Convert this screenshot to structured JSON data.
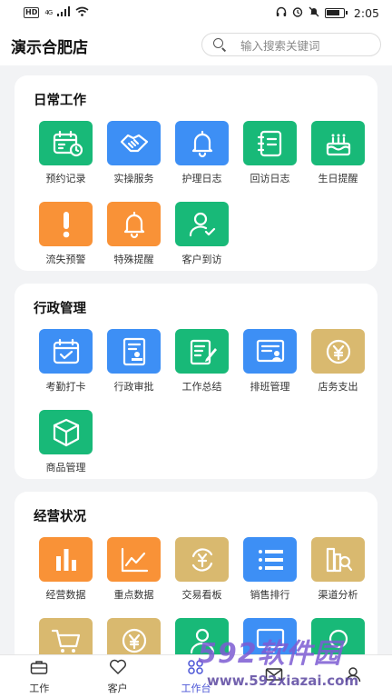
{
  "status_bar": {
    "hd": "HD",
    "network": "4G",
    "time": "2:05"
  },
  "header": {
    "store_name": "演示合肥店",
    "search_placeholder": "输入搜索关键词"
  },
  "sections": [
    {
      "title": "日常工作",
      "items": [
        {
          "label": "预约记录",
          "icon": "calendar-clock-icon",
          "color": "#18b978"
        },
        {
          "label": "实操服务",
          "icon": "handshake-icon",
          "color": "#3d8ff5"
        },
        {
          "label": "护理日志",
          "icon": "bell-icon",
          "color": "#3d8ff5"
        },
        {
          "label": "回访日志",
          "icon": "notebook-icon",
          "color": "#18b978"
        },
        {
          "label": "生日提醒",
          "icon": "birthday-cake-icon",
          "color": "#18b978"
        },
        {
          "label": "流失预警",
          "icon": "exclamation-icon",
          "color": "#f99237"
        },
        {
          "label": "特殊提醒",
          "icon": "bell-icon",
          "color": "#f99237"
        },
        {
          "label": "客户到访",
          "icon": "user-check-icon",
          "color": "#18b978"
        }
      ]
    },
    {
      "title": "行政管理",
      "items": [
        {
          "label": "考勤打卡",
          "icon": "calendar-check-icon",
          "color": "#3d8ff5"
        },
        {
          "label": "行政审批",
          "icon": "approval-doc-icon",
          "color": "#3d8ff5"
        },
        {
          "label": "工作总结",
          "icon": "doc-pen-icon",
          "color": "#18b978"
        },
        {
          "label": "排班管理",
          "icon": "schedule-icon",
          "color": "#3d8ff5"
        },
        {
          "label": "店务支出",
          "icon": "yen-coin-icon",
          "color": "#d9b96f"
        },
        {
          "label": "商品管理",
          "icon": "box-icon",
          "color": "#18b978"
        }
      ]
    },
    {
      "title": "经营状况",
      "items": [
        {
          "label": "经营数据",
          "icon": "bar-chart-icon",
          "color": "#f99237"
        },
        {
          "label": "重点数据",
          "icon": "line-chart-icon",
          "color": "#f99237"
        },
        {
          "label": "交易看板",
          "icon": "yen-exchange-icon",
          "color": "#d9b96f"
        },
        {
          "label": "销售排行",
          "icon": "list-icon",
          "color": "#3d8ff5"
        },
        {
          "label": "渠道分析",
          "icon": "channel-analysis-icon",
          "color": "#d9b96f"
        },
        {
          "label": "",
          "icon": "cart-icon",
          "color": "#d9b96f"
        },
        {
          "label": "",
          "icon": "yen-coin-icon",
          "color": "#d9b96f"
        },
        {
          "label": "",
          "icon": "user-icon",
          "color": "#18b978"
        },
        {
          "label": "",
          "icon": "monitor-icon",
          "color": "#3d8ff5"
        },
        {
          "label": "",
          "icon": "circle-icon",
          "color": "#18b978"
        }
      ]
    }
  ],
  "tabbar": [
    {
      "label": "工作",
      "icon": "briefcase-icon",
      "active": false
    },
    {
      "label": "客户",
      "icon": "heart-icon",
      "active": false
    },
    {
      "label": "工作台",
      "icon": "grid-icon",
      "active": true
    },
    {
      "label": "",
      "icon": "mail-icon",
      "active": false
    },
    {
      "label": "",
      "icon": "person-icon",
      "active": false
    }
  ],
  "watermark": {
    "brand": "592软件园",
    "url": "www.592xiazai.com"
  }
}
